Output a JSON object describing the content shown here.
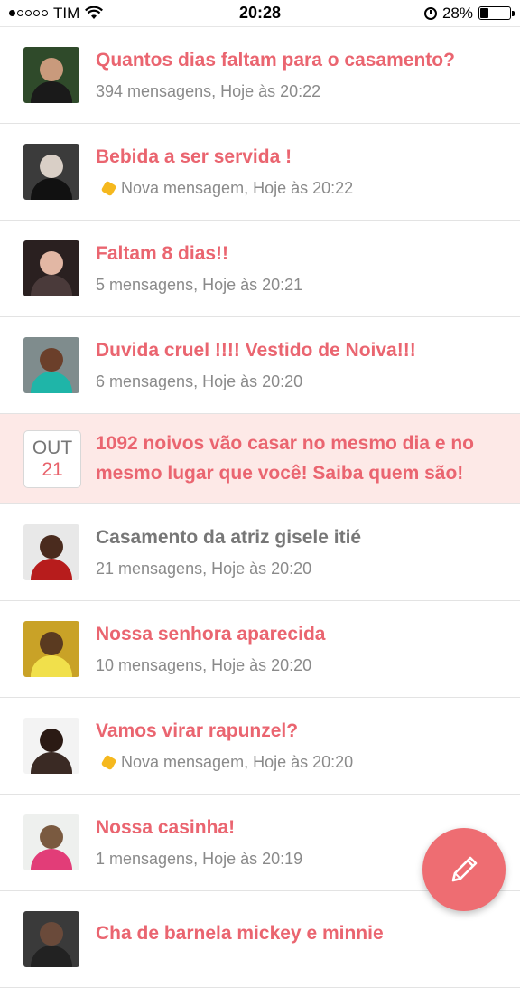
{
  "status_bar": {
    "carrier": "TIM",
    "time": "20:28",
    "battery": "28%",
    "battery_level": 0.28,
    "signal_filled": 1,
    "signal_total": 5
  },
  "threads": [
    {
      "title": "Quantos dias faltam para o casamento?",
      "meta": "394 mensagens, Hoje às 20:22",
      "is_new": false,
      "read": false,
      "avatar": {
        "bg": "#2f4a2a",
        "head": "#c99a7c",
        "body": "#1a1a1a"
      }
    },
    {
      "title": "Bebida a ser servida !",
      "meta": "Nova mensagem, Hoje às 20:22",
      "is_new": true,
      "read": false,
      "avatar": {
        "bg": "#3b3b3b",
        "head": "#d9cfc6",
        "body": "#111111"
      }
    },
    {
      "title": "Faltam 8 dias!!",
      "meta": "5 mensagens, Hoje às 20:21",
      "is_new": false,
      "read": false,
      "avatar": {
        "bg": "#2a2020",
        "head": "#e2b7a4",
        "body": "#4a3a3a"
      }
    },
    {
      "title": "Duvida cruel !!!! Vestido de Noiva!!!",
      "meta": "6 mensagens, Hoje às 20:20",
      "is_new": false,
      "read": false,
      "avatar": {
        "bg": "#7f8c8d",
        "head": "#6b3f2a",
        "body": "#1fb5a8"
      }
    },
    {
      "title": "Casamento da atriz gisele itié",
      "meta": "21 mensagens, Hoje às 20:20",
      "is_new": false,
      "read": true,
      "avatar": {
        "bg": "#e8e8e8",
        "head": "#4a2b1e",
        "body": "#b71c1c"
      }
    },
    {
      "title": "Nossa senhora aparecida",
      "meta": "10 mensagens, Hoje às 20:20",
      "is_new": false,
      "read": false,
      "avatar": {
        "bg": "#c9a227",
        "head": "#5a3a20",
        "body": "#f1e04b"
      }
    },
    {
      "title": "Vamos virar rapunzel?",
      "meta": "Nova mensagem, Hoje às 20:20",
      "is_new": true,
      "read": false,
      "avatar": {
        "bg": "#f3f3f3",
        "head": "#2b1a14",
        "body": "#3a2a24"
      }
    },
    {
      "title": "Nossa casinha!",
      "meta": "1 mensagens, Hoje às 20:19",
      "is_new": false,
      "read": false,
      "avatar": {
        "bg": "#eef0ee",
        "head": "#7a5a40",
        "body": "#e23d78"
      }
    },
    {
      "title": "Cha de barnela mickey e minnie",
      "meta": "",
      "is_new": false,
      "read": false,
      "avatar": {
        "bg": "#3a3a3a",
        "head": "#6a4a3a",
        "body": "#222222"
      }
    }
  ],
  "ad": {
    "month": "OUT",
    "day": "21",
    "title": "1092 noivos vão casar no mesmo dia e no mesmo lugar que você! Saiba quem são!"
  },
  "fab": {
    "icon": "pencil-icon",
    "color": "#ee6d72"
  }
}
